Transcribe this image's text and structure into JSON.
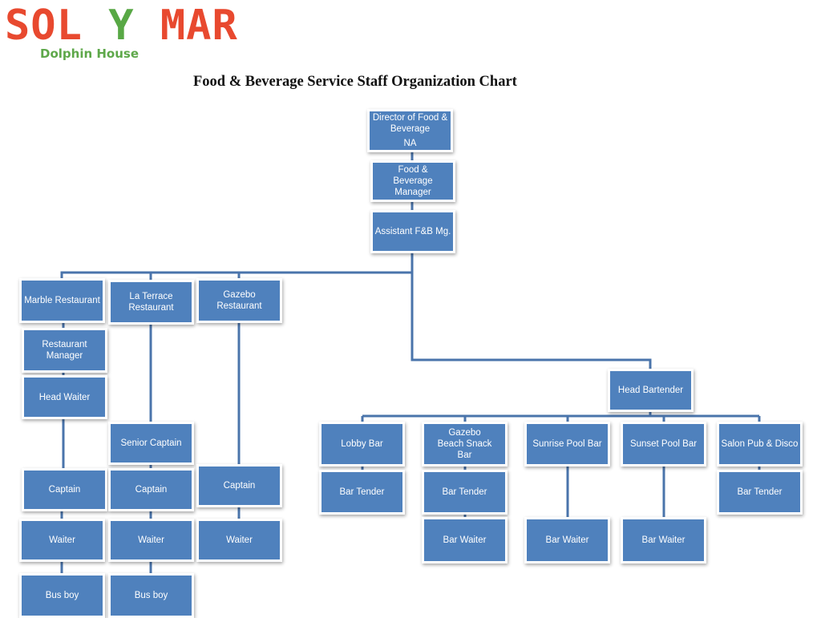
{
  "logo": {
    "brand_part1": "SOL ",
    "brand_part2": "Y",
    "brand_part3": " MAR",
    "subtitle": "Dolphin House",
    "colors": {
      "primary": "#e8492f",
      "accent": "#58a845"
    }
  },
  "title": "Food & Beverage Service Staff Organization Chart",
  "colors": {
    "box_fill": "#4f81bd",
    "connector": "#4a74ab",
    "box_text": "#ffffff"
  },
  "nodes": {
    "director": {
      "label": "Director of Food & Beverage",
      "sub": "NA"
    },
    "fb_manager": {
      "label": "Food & Beverage Manager"
    },
    "asst_fb": {
      "label": "Assistant F&B Mg."
    },
    "marble": {
      "label": "Marble Restaurant"
    },
    "la_terrace": {
      "label": "La Terrace Restaurant"
    },
    "gazebo_rest": {
      "label": "Gazebo Restaurant"
    },
    "rest_manager": {
      "label": "Restaurant Manager"
    },
    "head_waiter": {
      "label": "Head Waiter"
    },
    "senior_captain": {
      "label": "Senior Captain"
    },
    "captain_marble": {
      "label": "Captain"
    },
    "captain_terrace": {
      "label": "Captain"
    },
    "captain_gazebo": {
      "label": "Captain"
    },
    "waiter_marble": {
      "label": "Waiter"
    },
    "waiter_terrace": {
      "label": "Waiter"
    },
    "waiter_gazebo": {
      "label": "Waiter"
    },
    "busboy_marble": {
      "label": "Bus boy"
    },
    "busboy_terrace": {
      "label": "Bus boy"
    },
    "head_bartender": {
      "label": "Head Bartender"
    },
    "lobby_bar": {
      "label": "Lobby Bar"
    },
    "gazebo_beach": {
      "label": "Gazebo Beach Snack Bar"
    },
    "sunrise_pool": {
      "label": "Sunrise Pool Bar"
    },
    "sunset_pool": {
      "label": "Sunset Pool Bar"
    },
    "salon_pub": {
      "label": "Salon Pub & Disco"
    },
    "bartender_lobby": {
      "label": "Bar Tender"
    },
    "bartender_gazebo": {
      "label": "Bar Tender"
    },
    "bartender_salon": {
      "label": "Bar Tender"
    },
    "barwaiter_gazebo": {
      "label": "Bar Waiter"
    },
    "barwaiter_sunrise": {
      "label": "Bar Waiter"
    },
    "barwaiter_sunset": {
      "label": "Bar Waiter"
    }
  },
  "edges": [
    [
      "director",
      "fb_manager"
    ],
    [
      "fb_manager",
      "asst_fb"
    ],
    [
      "asst_fb",
      "marble"
    ],
    [
      "asst_fb",
      "la_terrace"
    ],
    [
      "asst_fb",
      "gazebo_rest"
    ],
    [
      "asst_fb",
      "head_bartender"
    ],
    [
      "marble",
      "rest_manager"
    ],
    [
      "rest_manager",
      "head_waiter"
    ],
    [
      "head_waiter",
      "captain_marble"
    ],
    [
      "captain_marble",
      "waiter_marble"
    ],
    [
      "waiter_marble",
      "busboy_marble"
    ],
    [
      "la_terrace",
      "senior_captain"
    ],
    [
      "senior_captain",
      "captain_terrace"
    ],
    [
      "captain_terrace",
      "waiter_terrace"
    ],
    [
      "waiter_terrace",
      "busboy_terrace"
    ],
    [
      "gazebo_rest",
      "captain_gazebo"
    ],
    [
      "captain_gazebo",
      "waiter_gazebo"
    ],
    [
      "head_bartender",
      "lobby_bar"
    ],
    [
      "head_bartender",
      "gazebo_beach"
    ],
    [
      "head_bartender",
      "sunrise_pool"
    ],
    [
      "head_bartender",
      "sunset_pool"
    ],
    [
      "head_bartender",
      "salon_pub"
    ],
    [
      "lobby_bar",
      "bartender_lobby"
    ],
    [
      "gazebo_beach",
      "bartender_gazebo"
    ],
    [
      "bartender_gazebo",
      "barwaiter_gazebo"
    ],
    [
      "sunrise_pool",
      "barwaiter_sunrise"
    ],
    [
      "sunset_pool",
      "barwaiter_sunset"
    ],
    [
      "salon_pub",
      "bartender_salon"
    ]
  ]
}
